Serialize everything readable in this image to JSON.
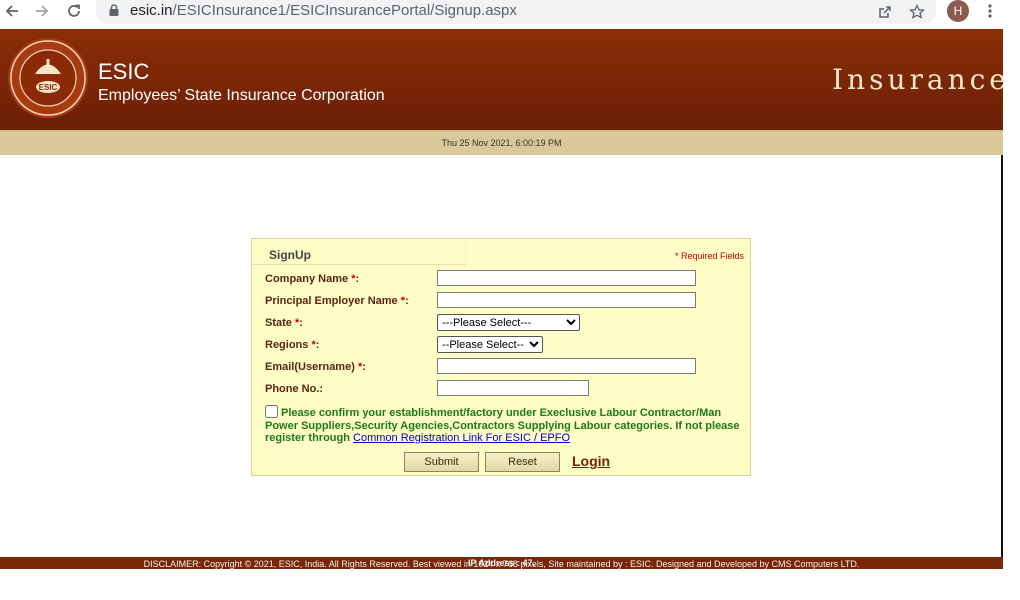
{
  "browser": {
    "url_host": "esic.in",
    "url_path": "/ESICInsurance1/ESICInsurancePortal/Signup.aspx",
    "avatar_letter": "H"
  },
  "header": {
    "brand_title": "ESIC",
    "brand_subtitle": "Employees’ State Insurance Corporation",
    "section_word": "Insurance",
    "logo_text": "ESIC",
    "colors": {
      "header": "#7a2606",
      "datebar": "#d9c99a",
      "panel": "#fefdc5"
    }
  },
  "datebar": {
    "text": "Thu 25 Nov 2021, 6:00:19 PM"
  },
  "form": {
    "title": "SignUp",
    "required_note": "* Required Fields",
    "fields": {
      "company_name": {
        "label": "Company Name ",
        "star": "*",
        "suffix": ":",
        "value": ""
      },
      "principal_employer": {
        "label": "Principal Employer Name ",
        "star": "*",
        "suffix": ":",
        "value": ""
      },
      "state": {
        "label": "State ",
        "star": "*",
        "suffix": ":",
        "selected": "---Please Select---"
      },
      "regions": {
        "label": "Regions ",
        "star": "*",
        "suffix": ":",
        "selected": "--Please Select--"
      },
      "email": {
        "label": "Email(Username) ",
        "star": "*",
        "suffix": ":",
        "value": ""
      },
      "phone": {
        "label": "Phone No.:",
        "value": ""
      }
    },
    "confirm_text": "Please confirm your establishment/factory under Execlusive Labour Contractor/Man Power Suppliers,Security Agencies,Contractors Supplying Labour categories. If not please register through ",
    "confirm_link": "Common Registration Link For ESIC / EPFO",
    "submit_label": "Submit",
    "reset_label": "Reset",
    "login_label": "Login"
  },
  "footer": {
    "text": "DISCLAIMER: Copyright © 2021, ESIC, India. All Rights Reserved. Best viewed in 1024 x 768 pixels, Site maintained by : ESIC. Designed and Developed by CMS Computers LTD.",
    "ip_text": "IP Address : 47."
  }
}
